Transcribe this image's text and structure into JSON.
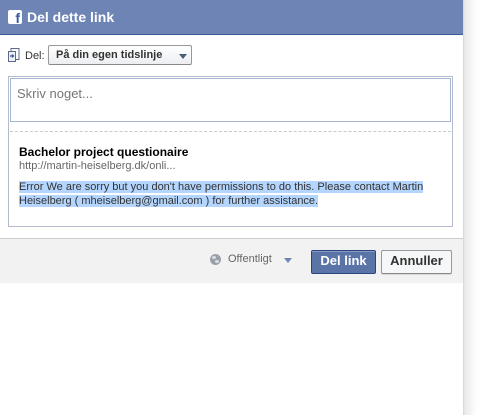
{
  "dialog": {
    "title": "Del dette link",
    "logo_letter": "f"
  },
  "share": {
    "label": "Del:",
    "selected": "På din egen tidslinje"
  },
  "composer": {
    "placeholder": "Skriv noget..."
  },
  "link_preview": {
    "title": "Bachelor project questionaire",
    "url": "http://martin-heiselberg.dk/onli...",
    "description": "Error We are sorry but you don't have permissions to do this. Please contact Martin Heiselberg ( mheiselberg@gmail.com ) for further assistance."
  },
  "footer": {
    "privacy_label": "Offentligt",
    "share_button": "Del link",
    "cancel_button": "Annuller"
  },
  "colors": {
    "header_bg": "#6d84b4",
    "primary_button": "#5b74a8",
    "selection_highlight": "#b4d5fe"
  },
  "icons": {
    "logo": "facebook-logo-icon",
    "share": "share-page-icon",
    "dropdown": "chevron-down-icon",
    "privacy": "globe-icon"
  }
}
